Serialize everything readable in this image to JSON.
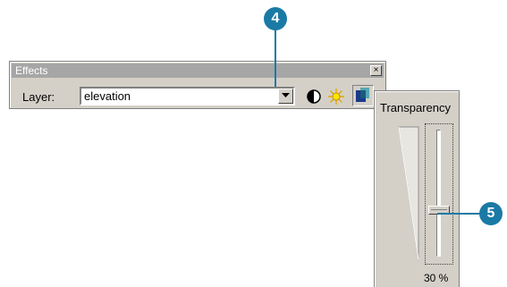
{
  "effects_window": {
    "title": "Effects",
    "close_glyph": "×",
    "layer_label": "Layer:",
    "layer_value": "elevation",
    "tools": [
      "contrast-icon",
      "brightness-icon",
      "transparency-icon"
    ]
  },
  "transparency_panel": {
    "title": "Transparency",
    "value": 30,
    "value_label": "30 %"
  },
  "callouts": {
    "step4": "4",
    "step5": "5",
    "color": "#1a7aa5"
  }
}
